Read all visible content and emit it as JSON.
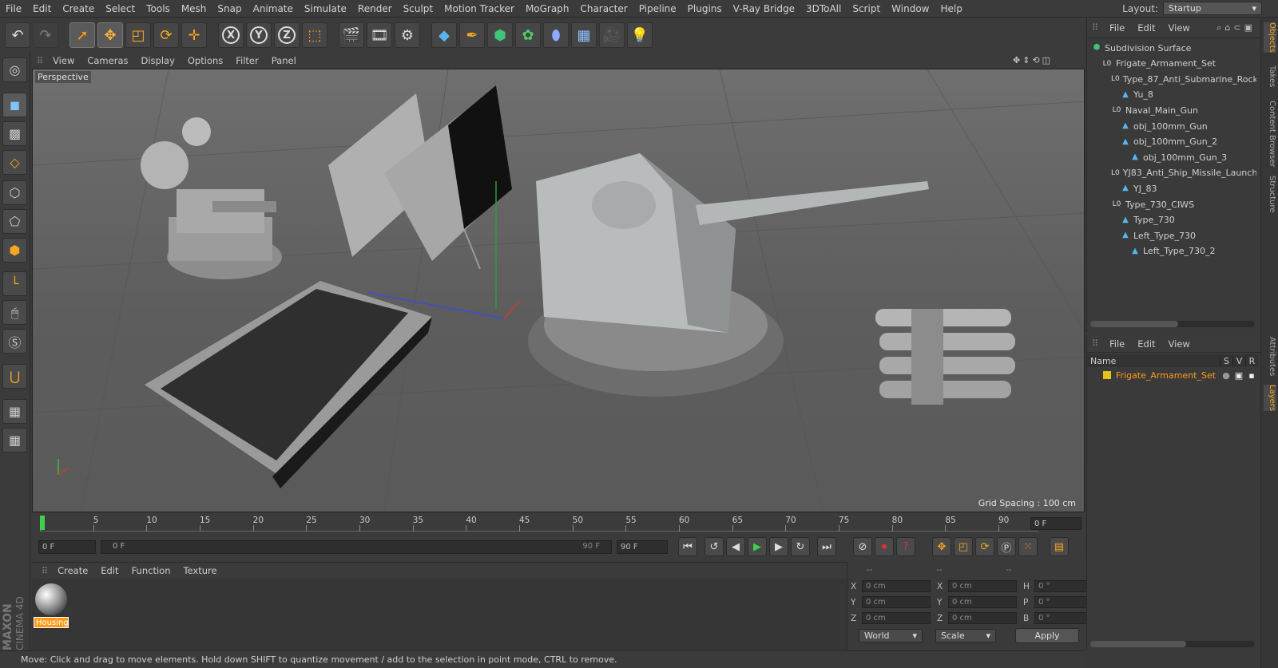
{
  "menu": [
    "File",
    "Edit",
    "Create",
    "Select",
    "Tools",
    "Mesh",
    "Snap",
    "Animate",
    "Simulate",
    "Render",
    "Sculpt",
    "Motion Tracker",
    "MoGraph",
    "Character",
    "Pipeline",
    "Plugins",
    "V-Ray Bridge",
    "3DToAll",
    "Script",
    "Window",
    "Help"
  ],
  "layout": {
    "label": "Layout:",
    "value": "Startup"
  },
  "toolbar": {
    "axis_x": "X",
    "axis_y": "Y",
    "axis_z": "Z"
  },
  "viewport": {
    "menu": [
      "View",
      "Cameras",
      "Display",
      "Options",
      "Filter",
      "Panel"
    ],
    "camera_label": "Perspective",
    "grid_spacing": "Grid Spacing : 100 cm"
  },
  "timeline": {
    "ticks": [
      "0",
      "5",
      "10",
      "15",
      "20",
      "25",
      "30",
      "35",
      "40",
      "45",
      "50",
      "55",
      "60",
      "65",
      "70",
      "75",
      "80",
      "85",
      "90"
    ],
    "current_frame": "0 F"
  },
  "playback": {
    "start_field": "0 F",
    "slider_left": "0 F",
    "slider_right": "90 F",
    "end_field": "90 F"
  },
  "material": {
    "menu": [
      "Create",
      "Edit",
      "Function",
      "Texture"
    ],
    "swatch_name": "Housing",
    "brand_top": "MAXON",
    "brand_bottom": "CINEMA 4D"
  },
  "coords": {
    "headers": [
      "--",
      "--",
      "--"
    ],
    "rows": [
      {
        "a": "X",
        "av": "0 cm",
        "b": "X",
        "bv": "0 cm",
        "c": "H",
        "cv": "0 °"
      },
      {
        "a": "Y",
        "av": "0 cm",
        "b": "Y",
        "bv": "0 cm",
        "c": "P",
        "cv": "0 °"
      },
      {
        "a": "Z",
        "av": "0 cm",
        "b": "Z",
        "bv": "0 cm",
        "c": "B",
        "cv": "0 °"
      }
    ],
    "space": "World",
    "mode": "Scale",
    "apply": "Apply"
  },
  "status": "Move: Click and drag to move elements. Hold down SHIFT to quantize movement / add to the selection in point mode, CTRL to remove.",
  "objects": {
    "menu": [
      "File",
      "Edit",
      "View"
    ],
    "tree": [
      {
        "label": "Subdivision Surface",
        "depth": 0,
        "kind": "subdiv"
      },
      {
        "label": "Frigate_Armament_Set",
        "depth": 1,
        "kind": "null"
      },
      {
        "label": "Type_87_Anti_Submarine_Rock",
        "depth": 2,
        "kind": "null"
      },
      {
        "label": "Yu_8",
        "depth": 3,
        "kind": "poly"
      },
      {
        "label": "Naval_Main_Gun",
        "depth": 2,
        "kind": "null"
      },
      {
        "label": "obj_100mm_Gun",
        "depth": 3,
        "kind": "poly"
      },
      {
        "label": "obj_100mm_Gun_2",
        "depth": 3,
        "kind": "poly"
      },
      {
        "label": "obj_100mm_Gun_3",
        "depth": 4,
        "kind": "poly"
      },
      {
        "label": "YJ83_Anti_Ship_Missile_Launch",
        "depth": 2,
        "kind": "null"
      },
      {
        "label": "YJ_83",
        "depth": 3,
        "kind": "poly"
      },
      {
        "label": "Type_730_CIWS",
        "depth": 2,
        "kind": "null"
      },
      {
        "label": "Type_730",
        "depth": 3,
        "kind": "poly"
      },
      {
        "label": "Left_Type_730",
        "depth": 3,
        "kind": "poly"
      },
      {
        "label": "Left_Type_730_2",
        "depth": 4,
        "kind": "poly"
      }
    ]
  },
  "layers": {
    "menu": [
      "File",
      "Edit",
      "View"
    ],
    "columns": {
      "name": "Name",
      "s": "S",
      "v": "V",
      "r": "R"
    },
    "rows": [
      {
        "name": "Frigate_Armament_Set",
        "color": "#e6c21f"
      }
    ]
  },
  "right_tabs": [
    "Objects",
    "Takes",
    "Content Browser",
    "Structure",
    "Attributes",
    "Layers"
  ],
  "colors": {
    "accent": "#f5a623",
    "select_orange": "#ff9b1a",
    "layer_yellow": "#e6c21f"
  }
}
